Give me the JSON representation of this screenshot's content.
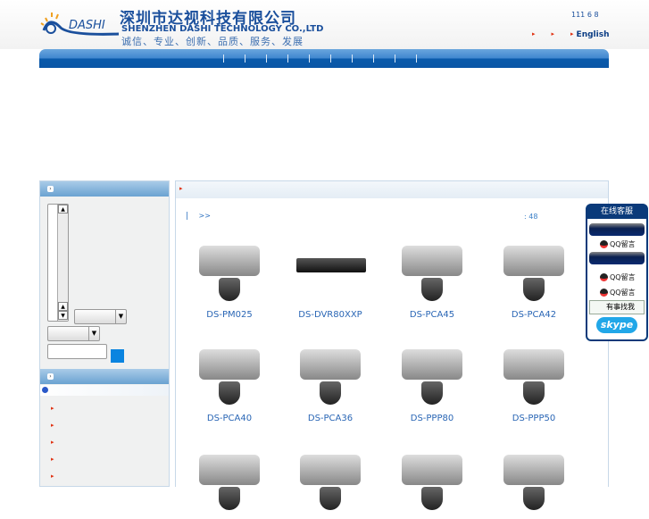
{
  "header": {
    "logo_text": "DASHI",
    "company_cn": "深圳市达视科技有限公司",
    "company_en": "SHENZHEN DASHI TECHNOLOGY CO.,LTD",
    "slogan": "诚信、专业、创新、品质、服务、发展",
    "phone": "111 6 8",
    "lang_link": "English"
  },
  "nav": {
    "separators": 9
  },
  "main": {
    "breadcrumb_sep": "|",
    "breadcrumb": ">>",
    "count": ": 48",
    "products": [
      {
        "name": "DS-PM025"
      },
      {
        "name": "DS-DVR80XXP"
      },
      {
        "name": "DS-PCA45"
      },
      {
        "name": "DS-PCA42"
      },
      {
        "name": "DS-PCA40"
      },
      {
        "name": "DS-PCA36"
      },
      {
        "name": "DS-PPP80"
      },
      {
        "name": "DS-PPP50"
      },
      {
        "name": ""
      },
      {
        "name": ""
      },
      {
        "name": ""
      },
      {
        "name": ""
      }
    ]
  },
  "float": {
    "title": "在线客服",
    "qq1": "QQ留言",
    "qq2": "QQ留言",
    "qq3": "QQ留言",
    "msn": "有事找我",
    "skype": "skype"
  },
  "colors": {
    "brand": "#1a4f9c",
    "nav": "#0a56a6",
    "accent": "#e03010"
  }
}
